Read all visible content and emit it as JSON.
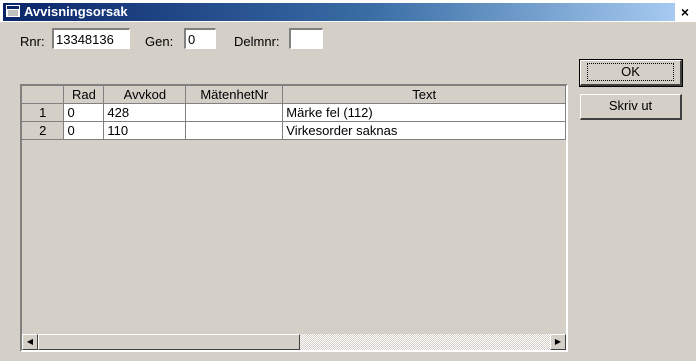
{
  "window": {
    "title": "Avvisningsorsak",
    "close": "×"
  },
  "fields": {
    "rnr_label": "Rnr:",
    "rnr_value": "13348136",
    "gen_label": "Gen:",
    "gen_value": "0",
    "delmnr_label": "Delmnr:",
    "delmnr_value": ""
  },
  "grid": {
    "columns": [
      "",
      "Rad",
      "Avvkod",
      "MätenhetNr",
      "Text"
    ],
    "rows": [
      {
        "num": "1",
        "rad": "0",
        "avvkod": "428",
        "matenhet": "",
        "text": "Märke fel (112)"
      },
      {
        "num": "2",
        "rad": "0",
        "avvkod": "110",
        "matenhet": "",
        "text": "Virkesorder saknas"
      }
    ]
  },
  "buttons": {
    "ok": "OK",
    "print": "Skriv ut"
  },
  "icons": {
    "title": "window-icon",
    "scroll_left": "arrow-left-icon",
    "scroll_right": "arrow-right-icon"
  }
}
